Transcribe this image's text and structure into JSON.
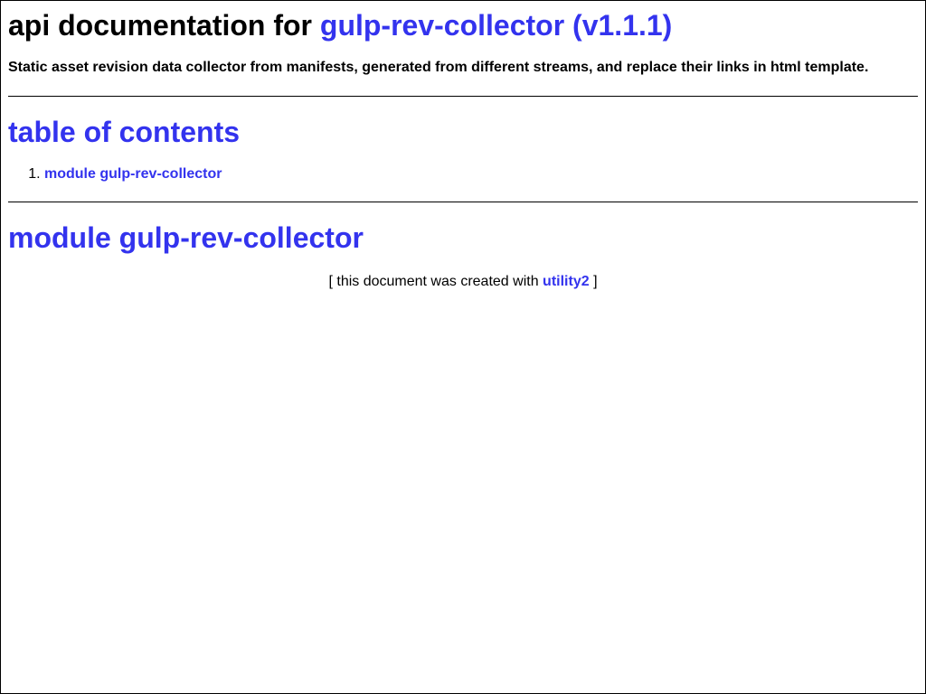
{
  "header": {
    "title_prefix": "api documentation for",
    "title_link": "gulp-rev-collector (v1.1.1)",
    "description": "Static asset revision data collector from manifests, generated from different streams, and replace their links in html template."
  },
  "toc": {
    "heading": "table of contents",
    "items": [
      {
        "label": "module gulp-rev-collector"
      }
    ]
  },
  "module": {
    "heading": "module gulp-rev-collector"
  },
  "footer": {
    "prefix": "[ this document was created with",
    "link": "utility2",
    "suffix": "]"
  },
  "colors": {
    "link": "#3333ee",
    "text": "#000000",
    "background": "#ffffff"
  }
}
